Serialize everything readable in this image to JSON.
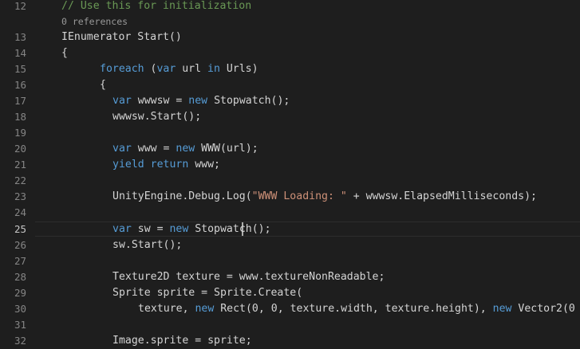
{
  "editor": {
    "colors": {
      "background": "#1e1e1e",
      "line_number": "#858585",
      "comment": "#6a9955",
      "keyword": "#569cd6",
      "string": "#ce9178",
      "text": "#d4d4d4"
    },
    "codelens": "0 references",
    "lines": [
      {
        "num": "12",
        "indent": 77,
        "tokens": [
          {
            "t": "cm",
            "v": "// Use this for initialization"
          }
        ]
      },
      {
        "num": "13",
        "indent": 77,
        "tokens": [
          {
            "t": "id",
            "v": "IEnumerator Start()"
          }
        ]
      },
      {
        "num": "14",
        "indent": 77,
        "tokens": [
          {
            "t": "id",
            "v": "{"
          }
        ]
      },
      {
        "num": "15",
        "indent": 125,
        "tokens": [
          {
            "t": "kw",
            "v": "foreach"
          },
          {
            "t": "id",
            "v": " ("
          },
          {
            "t": "kw",
            "v": "var"
          },
          {
            "t": "id",
            "v": " url "
          },
          {
            "t": "kw",
            "v": "in"
          },
          {
            "t": "id",
            "v": " Urls)"
          }
        ]
      },
      {
        "num": "16",
        "indent": 125,
        "tokens": [
          {
            "t": "id",
            "v": "{"
          }
        ]
      },
      {
        "num": "17",
        "indent": 141,
        "tokens": [
          {
            "t": "kw",
            "v": "var"
          },
          {
            "t": "id",
            "v": " wwwsw = "
          },
          {
            "t": "kw",
            "v": "new"
          },
          {
            "t": "id",
            "v": " Stopwatch();"
          }
        ]
      },
      {
        "num": "18",
        "indent": 141,
        "tokens": [
          {
            "t": "id",
            "v": "wwwsw.Start();"
          }
        ]
      },
      {
        "num": "19",
        "indent": 141,
        "tokens": []
      },
      {
        "num": "20",
        "indent": 141,
        "tokens": [
          {
            "t": "kw",
            "v": "var"
          },
          {
            "t": "id",
            "v": " www = "
          },
          {
            "t": "kw",
            "v": "new"
          },
          {
            "t": "id",
            "v": " WWW(url);"
          }
        ]
      },
      {
        "num": "21",
        "indent": 141,
        "tokens": [
          {
            "t": "kw",
            "v": "yield"
          },
          {
            "t": "id",
            "v": " "
          },
          {
            "t": "kw",
            "v": "return"
          },
          {
            "t": "id",
            "v": " www;"
          }
        ]
      },
      {
        "num": "22",
        "indent": 141,
        "tokens": []
      },
      {
        "num": "23",
        "indent": 141,
        "tokens": [
          {
            "t": "id",
            "v": "UnityEngine.Debug.Log("
          },
          {
            "t": "st",
            "v": "\"WWW Loading: \""
          },
          {
            "t": "id",
            "v": " + wwwsw.ElapsedMilliseconds);"
          }
        ]
      },
      {
        "num": "24",
        "indent": 141,
        "tokens": []
      },
      {
        "num": "25",
        "indent": 141,
        "tokens": [
          {
            "t": "kw",
            "v": "var"
          },
          {
            "t": "id",
            "v": " sw = "
          },
          {
            "t": "kw",
            "v": "new"
          },
          {
            "t": "id",
            "v": " Stopwatch();"
          }
        ]
      },
      {
        "num": "26",
        "indent": 141,
        "tokens": [
          {
            "t": "id",
            "v": "sw.Start();"
          }
        ]
      },
      {
        "num": "27",
        "indent": 141,
        "tokens": []
      },
      {
        "num": "28",
        "indent": 141,
        "tokens": [
          {
            "t": "id",
            "v": "Texture2D texture = www.textureNonReadable;"
          }
        ]
      },
      {
        "num": "29",
        "indent": 141,
        "tokens": [
          {
            "t": "id",
            "v": "Sprite sprite = Sprite.Create("
          }
        ]
      },
      {
        "num": "30",
        "indent": 173,
        "tokens": [
          {
            "t": "id",
            "v": "texture, "
          },
          {
            "t": "kw",
            "v": "new"
          },
          {
            "t": "id",
            "v": " Rect(0, 0, texture.width, texture.height), "
          },
          {
            "t": "kw",
            "v": "new"
          },
          {
            "t": "id",
            "v": " Vector2(0"
          }
        ]
      },
      {
        "num": "31",
        "indent": 141,
        "tokens": []
      },
      {
        "num": "32",
        "indent": 141,
        "tokens": [
          {
            "t": "id",
            "v": "Image.sprite = sprite;"
          }
        ]
      }
    ]
  }
}
